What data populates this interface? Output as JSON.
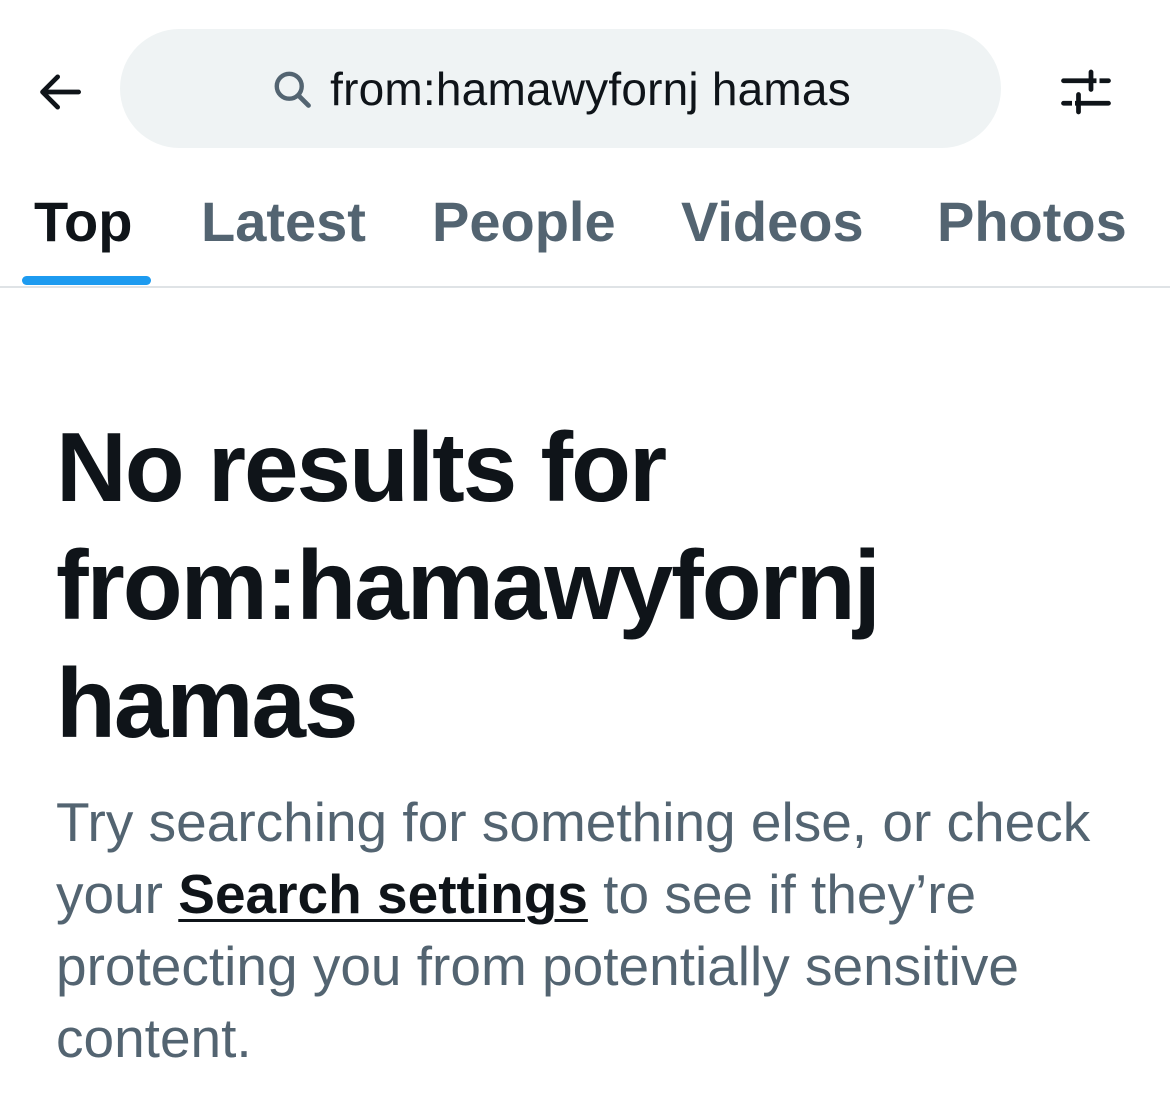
{
  "header": {
    "back_icon": "arrow-left-icon",
    "search": {
      "icon": "search-icon",
      "value": "from:hamawyfornj hamas"
    },
    "filter_icon": "sliders-icon"
  },
  "tabs": [
    {
      "label": "Top",
      "active": true
    },
    {
      "label": "Latest",
      "active": false
    },
    {
      "label": "People",
      "active": false
    },
    {
      "label": "Videos",
      "active": false
    },
    {
      "label": "Photos",
      "active": false
    }
  ],
  "empty_state": {
    "title_line1": "No results for",
    "title_line2": "from:hamawyfornj",
    "title_line3": "hamas",
    "desc_before_link": "Try searching for something else, or check your ",
    "link_label": "Search settings",
    "desc_after_link": " to see if they’re protecting you from potentially sensitive content."
  },
  "colors": {
    "accent": "#1d9bf0",
    "primary_text": "#0f1419",
    "secondary_text": "#536471",
    "search_bg": "#eff3f4",
    "divider": "#dfe3e6"
  }
}
